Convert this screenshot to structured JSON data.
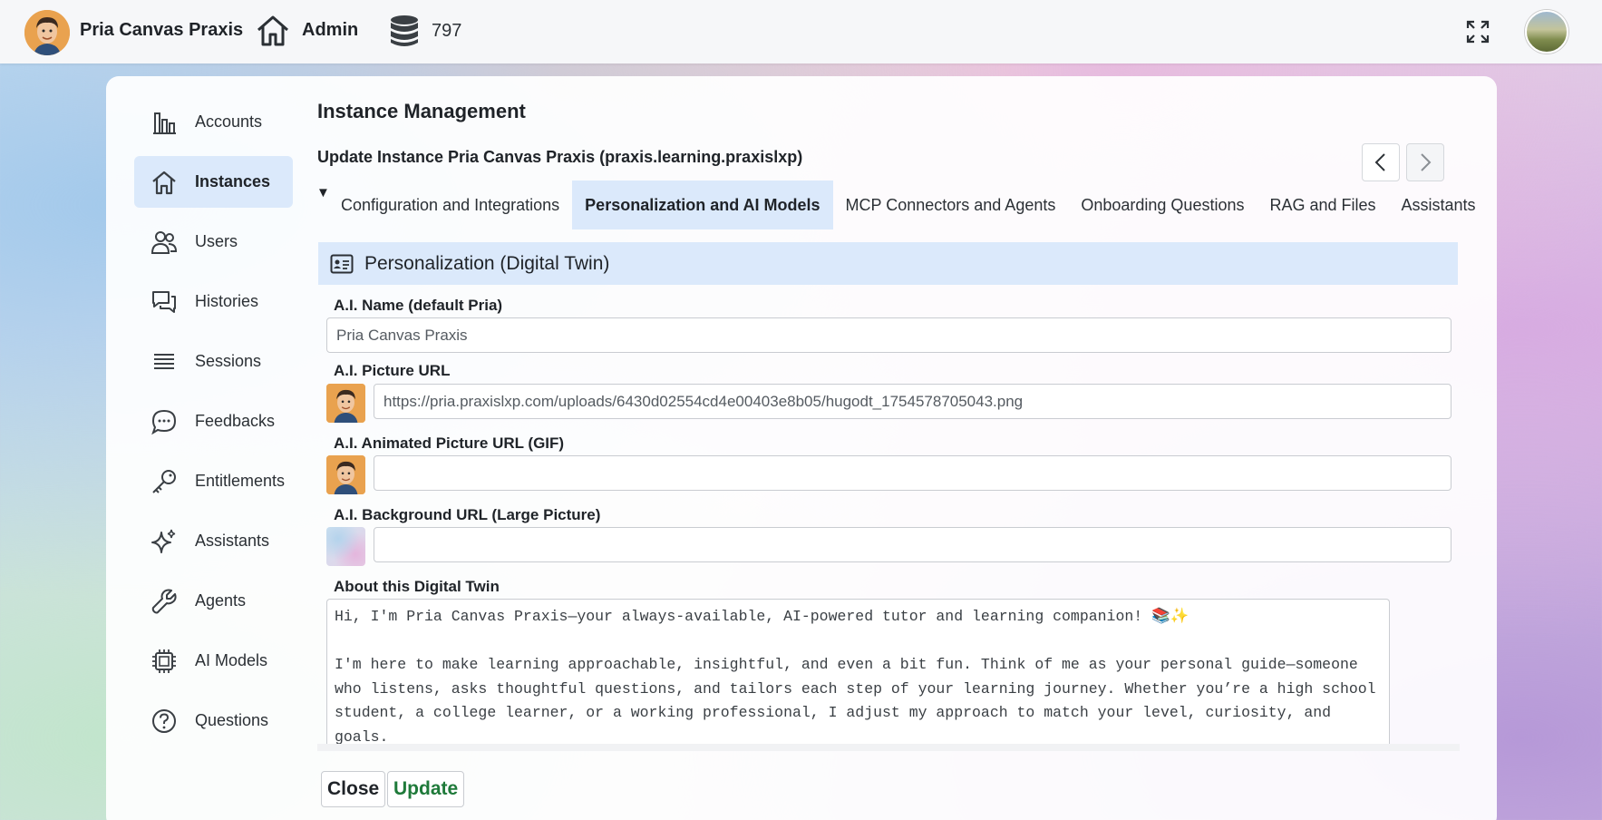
{
  "topbar": {
    "brand": "Pria Canvas Praxis",
    "admin_label": "Admin",
    "count": "797",
    "icons": [
      "avatar",
      "home-icon",
      "database-icon",
      "expand-icon",
      "user-avatar"
    ]
  },
  "sidebar": {
    "items": [
      {
        "label": "Accounts",
        "icon": "chart-icon",
        "active": false
      },
      {
        "label": "Instances",
        "icon": "home-icon",
        "active": true
      },
      {
        "label": "Users",
        "icon": "users-icon",
        "active": false
      },
      {
        "label": "Histories",
        "icon": "chat-bubbles-icon",
        "active": false
      },
      {
        "label": "Sessions",
        "icon": "list-icon",
        "active": false
      },
      {
        "label": "Feedbacks",
        "icon": "comment-icon",
        "active": false
      },
      {
        "label": "Entitlements",
        "icon": "key-icon",
        "active": false
      },
      {
        "label": "Assistants",
        "icon": "sparkles-icon",
        "active": false
      },
      {
        "label": "Agents",
        "icon": "wrench-icon",
        "active": false
      },
      {
        "label": "AI Models",
        "icon": "chip-icon",
        "active": false
      },
      {
        "label": "Questions",
        "icon": "question-circle-icon",
        "active": false
      }
    ]
  },
  "main": {
    "title": "Instance Management",
    "subtitle": "Update Instance Pria Canvas Praxis (praxis.learning.praxislxp)",
    "collapse_glyph": "▼",
    "tabs": [
      {
        "label": "Configuration and Integrations",
        "active": false
      },
      {
        "label": "Personalization and AI Models",
        "active": true
      },
      {
        "label": "MCP Connectors and Agents",
        "active": false
      },
      {
        "label": "Onboarding Questions",
        "active": false
      },
      {
        "label": "RAG and Files",
        "active": false
      },
      {
        "label": "Assistants",
        "active": false
      }
    ],
    "section_title": "Personalization (Digital Twin)",
    "fields": {
      "ai_name_label": "A.I. Name (default Pria)",
      "ai_name_value": "Pria Canvas Praxis",
      "picture_label": "A.I. Picture URL",
      "picture_value": "https://pria.praxislxp.com/uploads/6430d02554cd4e00403e8b05/hugodt_1754578705043.png",
      "animated_label": "A.I. Animated Picture URL (GIF)",
      "animated_value": "",
      "background_label": "A.I. Background URL (Large Picture)",
      "background_value": "",
      "about_label": "About this Digital Twin",
      "about_value": "Hi, I'm Pria Canvas Praxis—your always-available, AI-powered tutor and learning companion! 📚✨\n\nI'm here to make learning approachable, insightful, and even a bit fun. Think of me as your personal guide—someone who listens, asks thoughtful questions, and tailors each step of your learning journey. Whether you’re a high school student, a college learner, or a working professional, I adjust my approach to match your level, curiosity, and goals.\n\nWhat sets me apart?"
    },
    "buttons": {
      "close": "Close",
      "update": "Update"
    }
  },
  "colors": {
    "active_bg": "#dbe9fb",
    "update_green": "#1f7a3a"
  }
}
